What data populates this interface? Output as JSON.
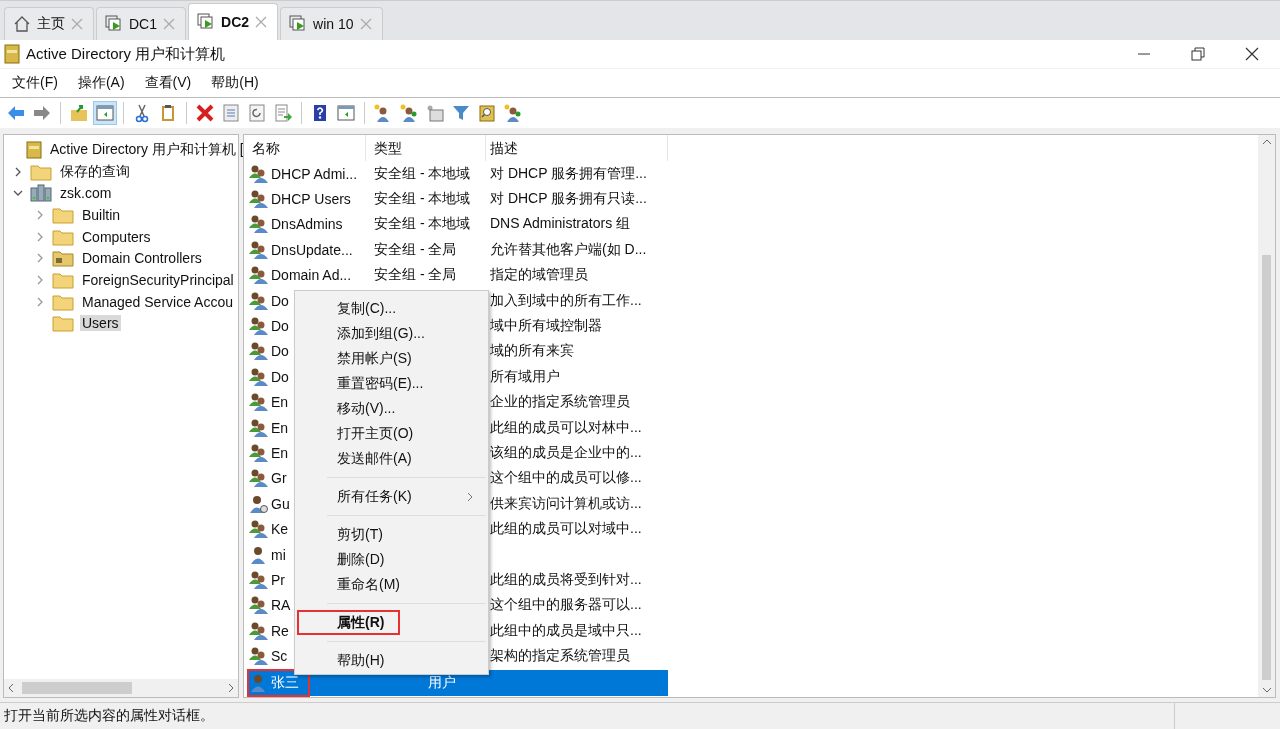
{
  "tabs": [
    {
      "label": "主页",
      "kind": "home",
      "selected": false
    },
    {
      "label": "DC1",
      "kind": "vm",
      "selected": false
    },
    {
      "label": "DC2",
      "kind": "vm",
      "selected": true
    },
    {
      "label": "win 10",
      "kind": "vm",
      "selected": false
    }
  ],
  "window": {
    "title": "Active Directory 用户和计算机"
  },
  "menu": [
    "文件(F)",
    "操作(A)",
    "查看(V)",
    "帮助(H)"
  ],
  "toolbar": [
    [
      {
        "pressed": false
      },
      {
        "pressed": false
      }
    ],
    [
      {
        "pressed": false
      },
      {
        "pressed": true
      }
    ],
    [
      {
        "pressed": false
      },
      {
        "pressed": false
      }
    ],
    [
      {
        "pressed": false
      },
      {
        "pressed": false
      },
      {
        "pressed": false
      },
      {
        "pressed": false
      }
    ],
    [
      {
        "pressed": false
      },
      {
        "pressed": false
      }
    ],
    [
      {
        "pressed": false
      },
      {
        "pressed": false
      },
      {
        "pressed": false
      },
      {
        "pressed": false
      },
      {
        "pressed": false
      },
      {
        "pressed": false
      }
    ]
  ],
  "tree": [
    {
      "label": "Active Directory 用户和计算机 [",
      "kind": "root",
      "selected": false,
      "children": [
        {
          "label": "保存的查询",
          "kind": "folder",
          "expanded": false,
          "selected": false
        },
        {
          "label": "zsk.com",
          "kind": "domain",
          "expanded": true,
          "selected": false,
          "children": [
            {
              "label": "Builtin",
              "kind": "folder",
              "expanded": false,
              "selected": false
            },
            {
              "label": "Computers",
              "kind": "folder",
              "expanded": false,
              "selected": false
            },
            {
              "label": "Domain Controllers",
              "kind": "ou",
              "expanded": false,
              "selected": false
            },
            {
              "label": "ForeignSecurityPrincipal",
              "kind": "folder",
              "expanded": false,
              "selected": false
            },
            {
              "label": "Managed Service Accou",
              "kind": "folder",
              "expanded": false,
              "selected": false
            },
            {
              "label": "Users",
              "kind": "folder",
              "selected": true
            }
          ]
        }
      ]
    }
  ],
  "table": {
    "columns": [
      "名称",
      "类型",
      "描述"
    ],
    "rows": [
      {
        "kind": "group",
        "name": "DHCP Admi...",
        "type": "安全组 - 本地域",
        "description": "对 DHCP 服务拥有管理...",
        "selected": false
      },
      {
        "kind": "group",
        "name": "DHCP Users",
        "type": "安全组 - 本地域",
        "description": "对 DHCP 服务拥有只读...",
        "selected": false
      },
      {
        "kind": "group",
        "name": "DnsAdmins",
        "type": "安全组 - 本地域",
        "description": "DNS Administrators 组",
        "selected": false
      },
      {
        "kind": "group",
        "name": "DnsUpdate...",
        "type": "安全组 - 全局",
        "description": "允许替其他客户端(如 D...",
        "selected": false
      },
      {
        "kind": "group",
        "name": "Domain Ad...",
        "type": "安全组 - 全局",
        "description": "指定的域管理员",
        "selected": false
      },
      {
        "kind": "group",
        "name": "Do",
        "description": "加入到域中的所有工作...",
        "selected": false
      },
      {
        "kind": "group",
        "name": "Do",
        "description": "域中所有域控制器",
        "selected": false
      },
      {
        "kind": "group",
        "name": "Do",
        "description": "域的所有来宾",
        "selected": false
      },
      {
        "kind": "group",
        "name": "Do",
        "description": "所有域用户",
        "selected": false
      },
      {
        "kind": "group",
        "name": "En",
        "description": "企业的指定系统管理员",
        "selected": false
      },
      {
        "kind": "group",
        "name": "En",
        "description": "此组的成员可以对林中...",
        "selected": false
      },
      {
        "kind": "group",
        "name": "En",
        "description": "该组的成员是企业中的...",
        "selected": false
      },
      {
        "kind": "group",
        "name": "Gr",
        "description": "这个组中的成员可以修...",
        "selected": false
      },
      {
        "kind": "guest",
        "name": "Gu",
        "description": "供来宾访问计算机或访...",
        "selected": false
      },
      {
        "kind": "group",
        "name": "Ke",
        "description": "此组的成员可以对域中...",
        "selected": false
      },
      {
        "kind": "user",
        "name": "mi",
        "selected": false
      },
      {
        "kind": "group",
        "name": "Pr",
        "description": "此组的成员将受到针对...",
        "selected": false
      },
      {
        "kind": "group",
        "name": "RA",
        "description": "这个组中的服务器可以...",
        "selected": false
      },
      {
        "kind": "group",
        "name": "Re",
        "description": "此组中的成员是域中只...",
        "selected": false
      },
      {
        "kind": "group",
        "name": "Sc",
        "description": "架构的指定系统管理员",
        "selected": false
      },
      {
        "kind": "user",
        "name": "张三",
        "type": "用户",
        "selected": true,
        "outlined": true
      }
    ]
  },
  "context_menu": [
    [
      {
        "label": "复制(C)..."
      },
      {
        "label": "添加到组(G)..."
      },
      {
        "label": "禁用帐户(S)"
      },
      {
        "label": "重置密码(E)..."
      },
      {
        "label": "移动(V)..."
      },
      {
        "label": "打开主页(O)"
      },
      {
        "label": "发送邮件(A)"
      }
    ],
    [
      {
        "label": "所有任务(K)",
        "submenu": true
      }
    ],
    [
      {
        "label": "剪切(T)"
      },
      {
        "label": "删除(D)"
      },
      {
        "label": "重命名(M)"
      }
    ],
    [
      {
        "label": "属性(R)",
        "default": true,
        "outlined": true
      }
    ],
    [
      {
        "label": "帮助(H)"
      }
    ]
  ],
  "status_bar": "打开当前所选内容的属性对话框。"
}
